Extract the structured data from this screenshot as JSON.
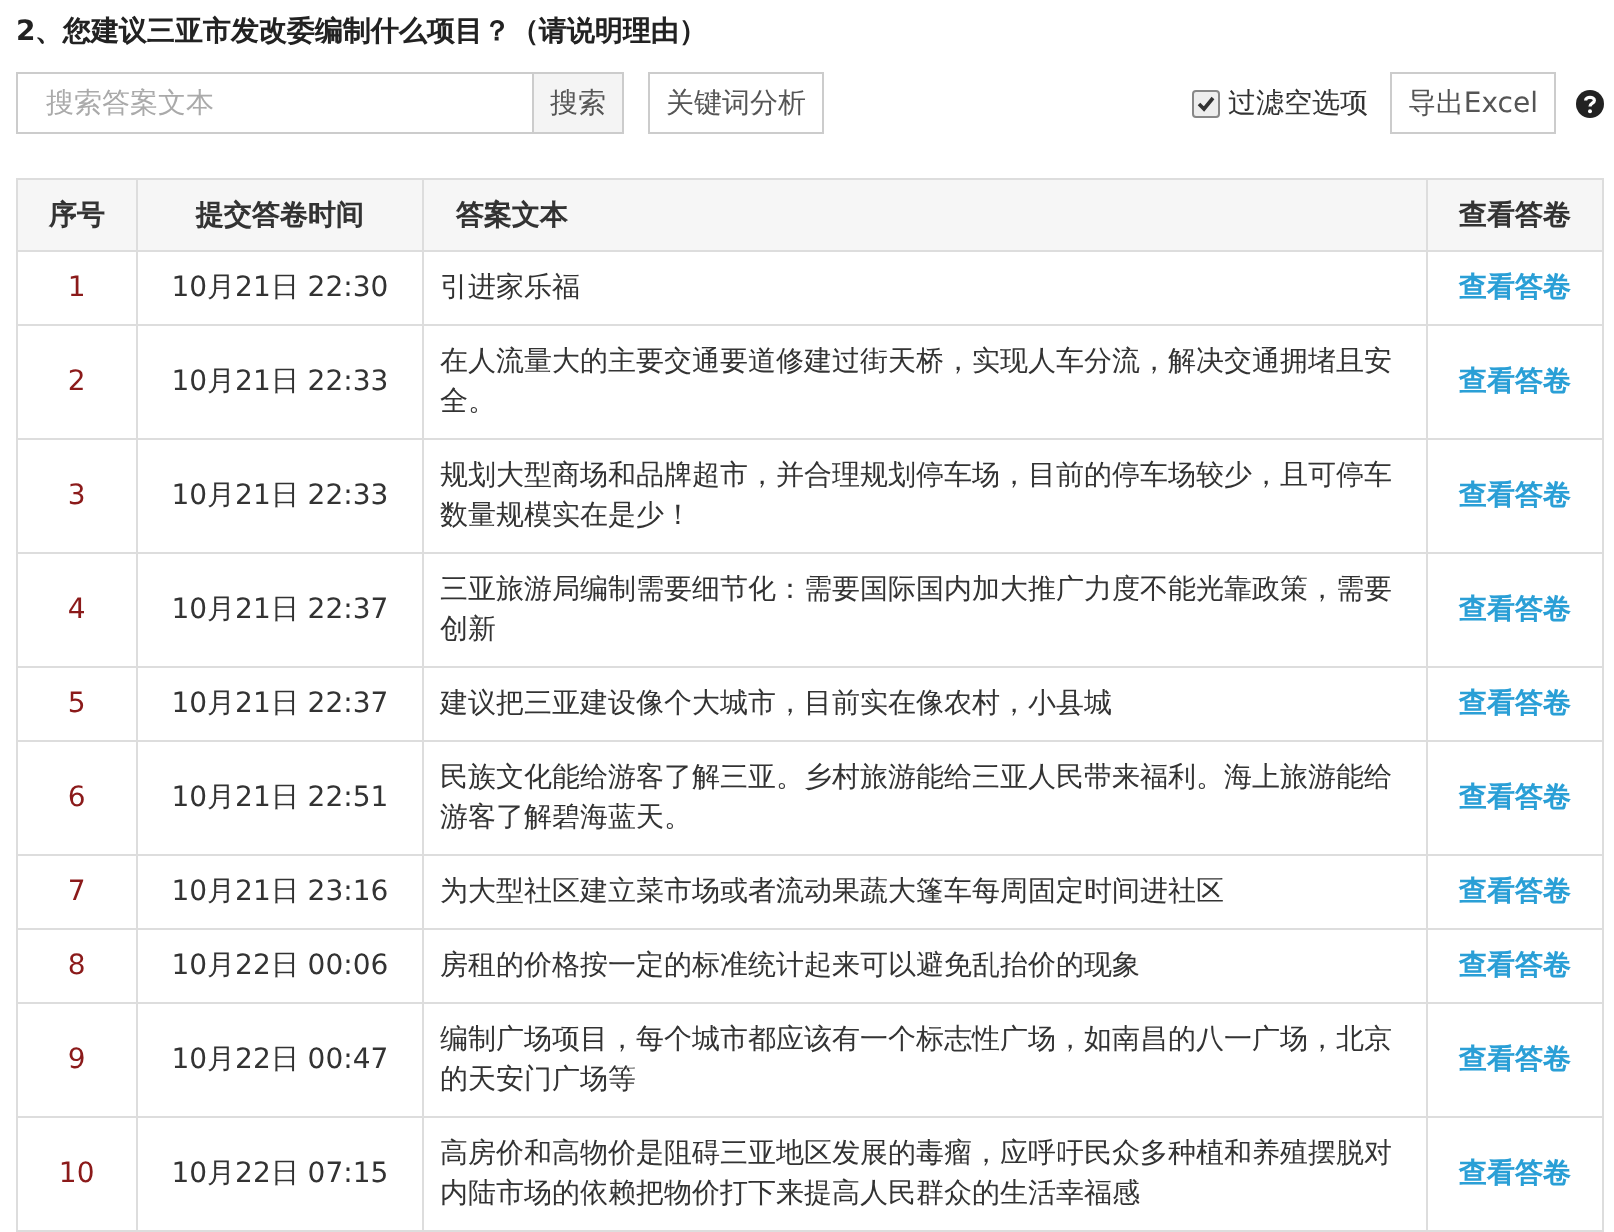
{
  "question": "2、您建议三亚市发改委编制什么项目？（请说明理由）",
  "search": {
    "placeholder": "搜索答案文本",
    "button": "搜索"
  },
  "keyword_button": "关键词分析",
  "filter": {
    "label": "过滤空选项",
    "checked": true
  },
  "export_button": "导出Excel",
  "table": {
    "columns": [
      "序号",
      "提交答卷时间",
      "答案文本",
      "查看答卷"
    ],
    "rows": [
      {
        "no": "1",
        "time": "10月21日 22:30",
        "text": "引进家乐福",
        "link": "查看答卷"
      },
      {
        "no": "2",
        "time": "10月21日 22:33",
        "text": "在人流量大的主要交通要道修建过街天桥，实现人车分流，解决交通拥堵且安全。",
        "link": "查看答卷"
      },
      {
        "no": "3",
        "time": "10月21日 22:33",
        "text": "规划大型商场和品牌超市，并合理规划停车场，目前的停车场较少，且可停车数量规模实在是少！",
        "link": "查看答卷"
      },
      {
        "no": "4",
        "time": "10月21日 22:37",
        "text": "三亚旅游局编制需要细节化：需要国际国内加大推广力度不能光靠政策，需要创新",
        "link": "查看答卷"
      },
      {
        "no": "5",
        "time": "10月21日 22:37",
        "text": "建议把三亚建设像个大城市，目前实在像农村，小县城",
        "link": "查看答卷"
      },
      {
        "no": "6",
        "time": "10月21日 22:51",
        "text": "民族文化能给游客了解三亚。乡村旅游能给三亚人民带来福利。海上旅游能给游客了解碧海蓝天。",
        "link": "查看答卷"
      },
      {
        "no": "7",
        "time": "10月21日 23:16",
        "text": "为大型社区建立菜市场或者流动果蔬大篷车每周固定时间进社区",
        "link": "查看答卷"
      },
      {
        "no": "8",
        "time": "10月22日 00:06",
        "text": "房租的价格按一定的标准统计起来可以避免乱抬价的现象",
        "link": "查看答卷"
      },
      {
        "no": "9",
        "time": "10月22日 00:47",
        "text": "编制广场项目，每个城市都应该有一个标志性广场，如南昌的八一广场，北京的天安门广场等",
        "link": "查看答卷"
      },
      {
        "no": "10",
        "time": "10月22日 07:15",
        "text": "高房价和高物价是阻碍三亚地区发展的毒瘤，应呼吁民众多种植和养殖摆脱对内陆市场的依赖把物价打下来提高人民群众的生活幸福感",
        "link": "查看答卷"
      }
    ]
  }
}
